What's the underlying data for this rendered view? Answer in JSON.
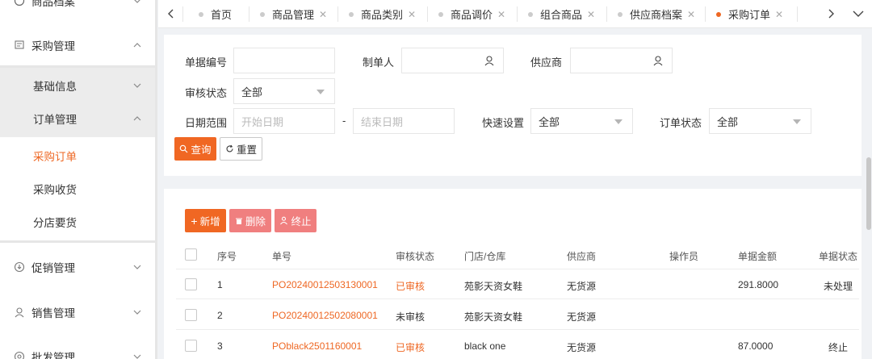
{
  "sidebar": {
    "top_partial_label": "商品档案",
    "purchase": {
      "label": "采购管理"
    },
    "basic_info": {
      "label": "基础信息"
    },
    "order_mgmt": {
      "label": "订单管理"
    },
    "sub_items": [
      {
        "label": "采购订单",
        "active": true
      },
      {
        "label": "采购收货",
        "active": false
      },
      {
        "label": "分店要货",
        "active": false
      }
    ],
    "promo": {
      "label": "促销管理"
    },
    "sales": {
      "label": "销售管理"
    },
    "wholesale": {
      "label": "批发管理"
    }
  },
  "tabs": [
    {
      "label": "首页",
      "closable": false
    },
    {
      "label": "商品管理",
      "closable": true
    },
    {
      "label": "商品类别",
      "closable": true
    },
    {
      "label": "商品调价",
      "closable": true
    },
    {
      "label": "组合商品",
      "closable": true
    },
    {
      "label": "供应商档案",
      "closable": true
    },
    {
      "label": "采购订单",
      "closable": true,
      "active": true
    }
  ],
  "tab_close_glyph": "✕",
  "filters": {
    "doc_no_label": "单据编号",
    "creator_label": "制单人",
    "supplier_label": "供应商",
    "audit_label": "审核状态",
    "audit_value": "全部",
    "date_label": "日期范围",
    "start_placeholder": "开始日期",
    "date_sep": "-",
    "end_placeholder": "结束日期",
    "quick_label": "快速设置",
    "quick_value": "全部",
    "order_status_label": "订单状态",
    "order_status_value": "全部",
    "query_btn": "查询",
    "reset_btn": "重置"
  },
  "actions": {
    "add": "新增",
    "delete": "删除",
    "stop": "终止"
  },
  "table": {
    "columns": [
      "序号",
      "单号",
      "审核状态",
      "门店/仓库",
      "供应商",
      "操作员",
      "单据金额",
      "单据状态"
    ],
    "rows": [
      {
        "idx": "1",
        "no": "PO20240012503130001",
        "audit": "已审核",
        "store": "苑影天资女鞋",
        "supplier": "无货源",
        "operator": "",
        "amount": "291.8000",
        "status": "未处理"
      },
      {
        "idx": "2",
        "no": "PO20240012502080001",
        "audit": "未审核",
        "store": "苑影天资女鞋",
        "supplier": "无货源",
        "operator": "",
        "amount": "",
        "status": ""
      },
      {
        "idx": "3",
        "no": "POblack2501160001",
        "audit": "已审核",
        "store": "black one",
        "supplier": "无货源",
        "operator": "",
        "amount": "87.0000",
        "status": "终止"
      }
    ]
  },
  "colors": {
    "accent": "#ee6723",
    "danger_light": "#f07f7f"
  }
}
